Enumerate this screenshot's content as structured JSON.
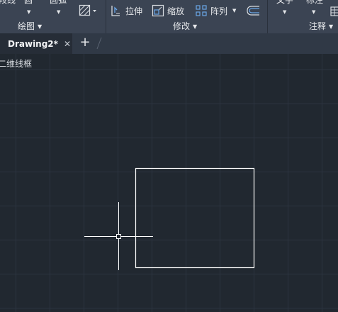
{
  "ribbon": {
    "top_row": [
      "段线",
      "圆",
      "圆弧",
      "文字",
      "标注"
    ],
    "panels": {
      "draw": "绘图",
      "modify": "修改",
      "annotate": "注释"
    },
    "tools": {
      "stretch": "拉伸",
      "scale": "缩放",
      "array": "阵列"
    }
  },
  "tabs": {
    "doc": "Drawing2*",
    "close": "✕",
    "new": "+"
  },
  "canvas": {
    "view_label": "二维线框"
  },
  "colors": {
    "ribbon_bg": "#3b4453",
    "canvas_bg": "#212830",
    "grid_line": "#2c3440",
    "geometry": "#ffffff"
  }
}
